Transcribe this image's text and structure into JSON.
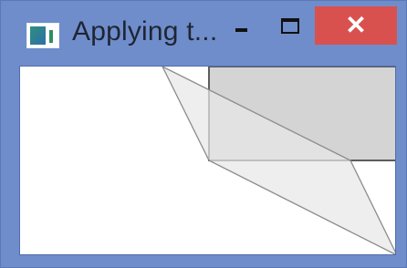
{
  "window": {
    "title": "Applying t...",
    "icon": "app-window-icon",
    "controls": {
      "minimize_icon": "minimize-icon",
      "maximize_icon": "maximize-icon",
      "close_icon": "close-icon",
      "close_glyph": "✕"
    }
  },
  "colors": {
    "frame": "#6f8dcb",
    "close": "#d9514f",
    "rect_fill": "#d4d4d4",
    "rect_stroke": "#5c5c5c",
    "para_fill": "#e8e8e8",
    "para_stroke": "#8c8c8c"
  }
}
